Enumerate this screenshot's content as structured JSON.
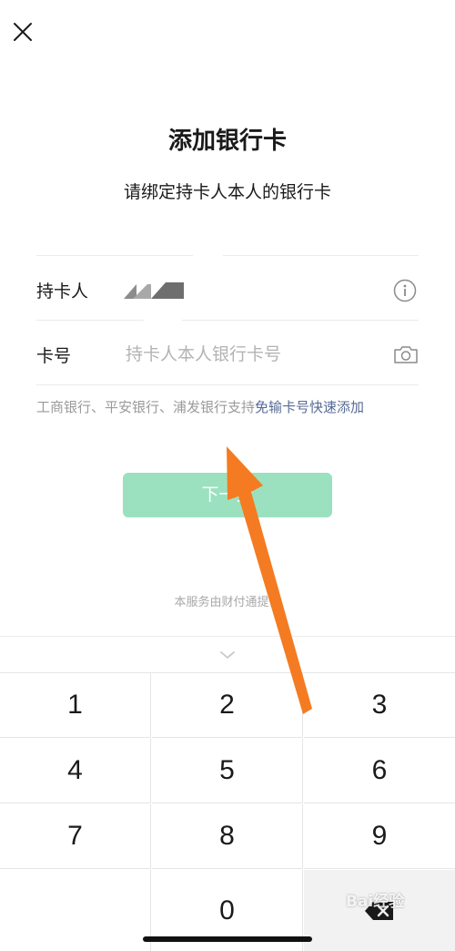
{
  "page": {
    "title": "添加银行卡",
    "subtitle": "请绑定持卡人本人的银行卡"
  },
  "form": {
    "holder_label": "持卡人",
    "card_label": "卡号",
    "card_placeholder": "持卡人本人银行卡号"
  },
  "hint": {
    "text": "工商银行、平安银行、浦发银行支持",
    "link": "免输卡号快速添加"
  },
  "next_button": "下一步",
  "footer_note": "本服务由财付通提供",
  "keypad": {
    "keys": [
      "1",
      "2",
      "3",
      "4",
      "5",
      "6",
      "7",
      "8",
      "9",
      "",
      "0",
      "delete"
    ]
  },
  "watermark": "Bai经验",
  "colors": {
    "button_bg": "#9be1c0",
    "link": "#576b95",
    "arrow": "#f47b22"
  }
}
